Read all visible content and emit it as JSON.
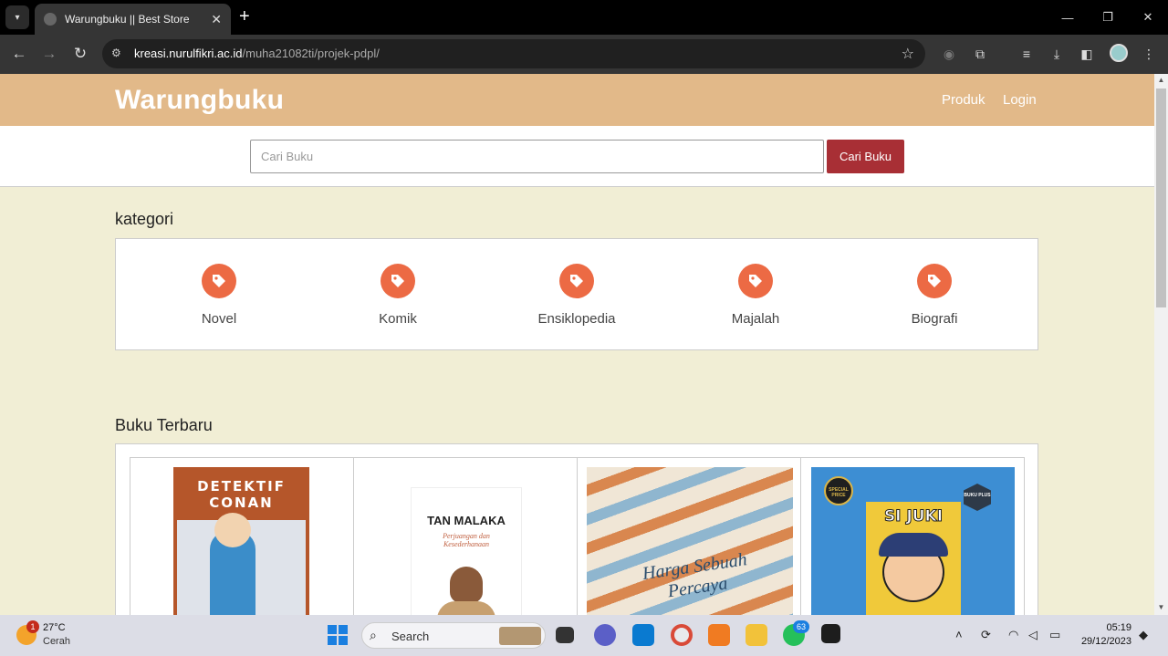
{
  "browser": {
    "tab_title": "Warungbuku || Best Store",
    "url_host": "kreasi.nurulfikri.ac.id",
    "url_path": "/muha21082ti/projek-pdpl/"
  },
  "site": {
    "brand": "Warungbuku",
    "nav": [
      "Produk",
      "Login"
    ],
    "search": {
      "placeholder": "Cari Buku",
      "button": "Cari Buku"
    },
    "kategori_title": "kategori",
    "categories": [
      "Novel",
      "Komik",
      "Ensiklopedia",
      "Majalah",
      "Biografi"
    ],
    "buku_title": "Buku Terbaru",
    "books": [
      {
        "cover_text": "DETEKTIF CONAN"
      },
      {
        "cover_text": "TAN MALAKA",
        "cover_sub": "Perjuangan dan Kesederhanaan"
      },
      {
        "cover_text": "Harga Sebuah Percaya"
      },
      {
        "cover_text": "SI JUKI",
        "badge": "SPECIAL PRICE",
        "tag": "BUKU PLUS"
      }
    ]
  },
  "taskbar": {
    "weather_temp": "27°C",
    "weather_cond": "Cerah",
    "weather_badge": "1",
    "search_label": "Search",
    "whatsapp_badge": "63",
    "time": "05:19",
    "date": "29/12/2023"
  }
}
